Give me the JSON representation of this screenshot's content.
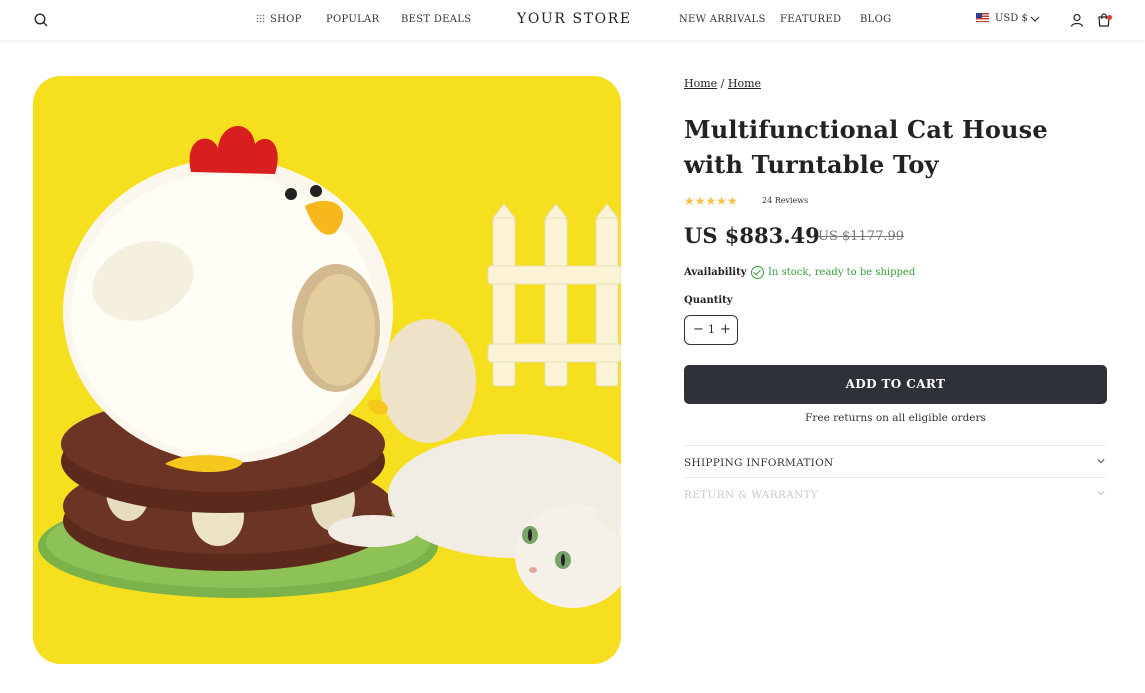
{
  "header": {
    "logo": "YOUR STORE",
    "nav_left": [
      "SHOP",
      "POPULAR",
      "BEST DEALS"
    ],
    "nav_right": [
      "NEW ARRIVALS",
      "FEATURED",
      "BLOG"
    ],
    "currency": "USD $",
    "icons": [
      "search-icon",
      "grid-icon",
      "us-flag-icon",
      "chevron-down-icon",
      "account-icon",
      "cart-icon"
    ]
  },
  "breadcrumb": [
    "Home",
    "Home"
  ],
  "product": {
    "title": "Multifunctional Cat House with Turntable Toy",
    "rating": 5,
    "reviews": "24 Reviews",
    "price": "US $883.49",
    "compare_price": "US $1177.99",
    "availability_label": "Availability",
    "availability_text": "In stock, ready to be shipped",
    "quantity_label": "Quantity",
    "quantity": "1",
    "add_to_cart": "ADD TO CART",
    "free_returns": "Free returns on all eligible orders"
  },
  "accordion": [
    {
      "label": "SHIPPING INFORMATION"
    },
    {
      "label": "RETURN & WARRANTY"
    }
  ],
  "colors": {
    "primary_button": "#2e3138",
    "stars": "#f5c242",
    "in_stock": "#3b9d3e",
    "image_background": "#f6df1e",
    "cart_badge": "#e53935"
  }
}
